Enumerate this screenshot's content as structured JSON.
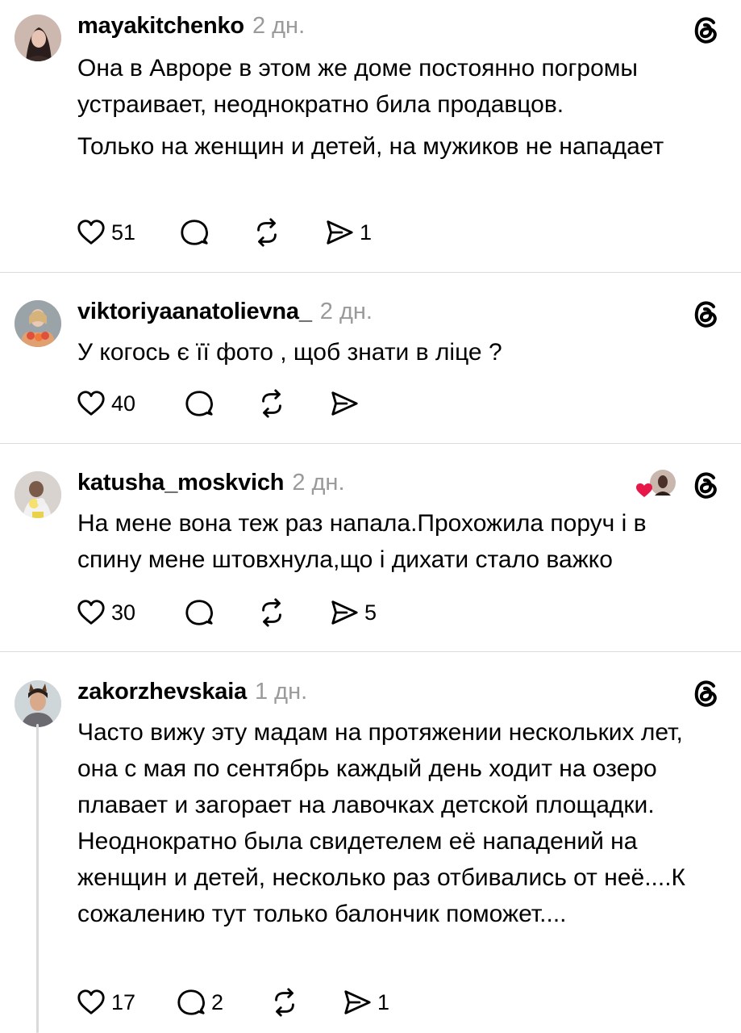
{
  "posts": [
    {
      "username": "mayakitchenko",
      "time": "2 дн.",
      "paragraphs": [
        "Она в Авроре в этом же доме постоянно погромы устраивает, неоднократно била продавцов.",
        "Только на женщин и детей, на мужиков не нападает"
      ],
      "likes": "51",
      "replies": "",
      "reposts": "",
      "shares": "1"
    },
    {
      "username": "viktoriyaanatolievna_",
      "time": "2 дн.",
      "paragraphs": [
        "У когось є її фото , щоб знати в ліце ?"
      ],
      "likes": "40",
      "replies": "",
      "reposts": "",
      "shares": ""
    },
    {
      "username": "katusha_moskvich",
      "time": "2 дн.",
      "paragraphs": [
        "На мене вона теж раз напала.Прохожила поруч і в спину мене штовхнула,що і дихати стало важко"
      ],
      "likes": "30",
      "replies": "",
      "reposts": "",
      "shares": "5"
    },
    {
      "username": "zakorzhevskaia",
      "time": "1 дн.",
      "paragraphs": [
        "Часто вижу эту мадам на протяжении нескольких лет, она с мая по сентябрь каждый день ходит на озеро плавает и загорает на лавочках детской площадки. Неоднократно была свидетелем её нападений на женщин и детей, несколько раз отбивались от неё....К сожалению тут только балончик поможет...."
      ],
      "likes": "17",
      "replies": "2",
      "reposts": "",
      "shares": "1"
    }
  ],
  "icons": {
    "like": "heart-icon",
    "reply": "comment-icon",
    "repost": "repost-icon",
    "share": "send-icon",
    "app": "threads-logo-icon",
    "liked_by": "creator-liked-heart-icon"
  },
  "colors": {
    "liked_heart": "#e8174a",
    "meta_gray": "#9a9a9a",
    "divider": "#dcdcdc"
  }
}
